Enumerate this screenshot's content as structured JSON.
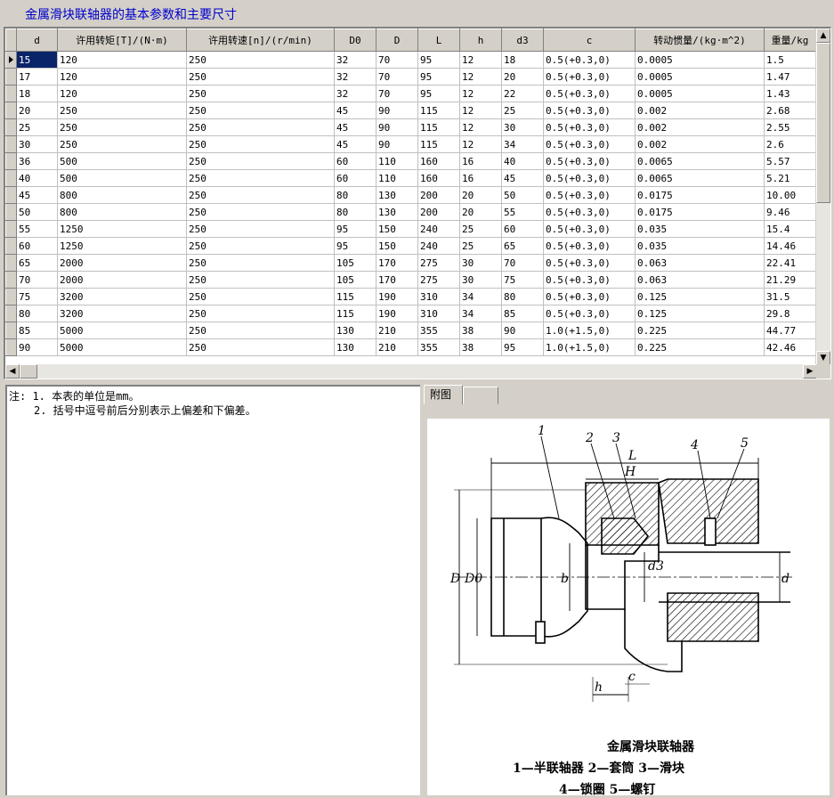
{
  "window": {
    "title": "金属滑块联轴器的基本参数和主要尺寸"
  },
  "table": {
    "columns": [
      "d",
      "许用转矩[T]/(N·m)",
      "许用转速[n]/(r/min)",
      "D0",
      "D",
      "L",
      "h",
      "d3",
      "c",
      "转动惯量/(kg·m^2)",
      "重量/kg"
    ],
    "rows": [
      [
        "15",
        "120",
        "250",
        "32",
        "70",
        "95",
        "12",
        "18",
        "0.5(+0.3,0)",
        "0.0005",
        "1.5"
      ],
      [
        "17",
        "120",
        "250",
        "32",
        "70",
        "95",
        "12",
        "20",
        "0.5(+0.3,0)",
        "0.0005",
        "1.47"
      ],
      [
        "18",
        "120",
        "250",
        "32",
        "70",
        "95",
        "12",
        "22",
        "0.5(+0.3,0)",
        "0.0005",
        "1.43"
      ],
      [
        "20",
        "250",
        "250",
        "45",
        "90",
        "115",
        "12",
        "25",
        "0.5(+0.3,0)",
        "0.002",
        "2.68"
      ],
      [
        "25",
        "250",
        "250",
        "45",
        "90",
        "115",
        "12",
        "30",
        "0.5(+0.3,0)",
        "0.002",
        "2.55"
      ],
      [
        "30",
        "250",
        "250",
        "45",
        "90",
        "115",
        "12",
        "34",
        "0.5(+0.3,0)",
        "0.002",
        "2.6"
      ],
      [
        "36",
        "500",
        "250",
        "60",
        "110",
        "160",
        "16",
        "40",
        "0.5(+0.3,0)",
        "0.0065",
        "5.57"
      ],
      [
        "40",
        "500",
        "250",
        "60",
        "110",
        "160",
        "16",
        "45",
        "0.5(+0.3,0)",
        "0.0065",
        "5.21"
      ],
      [
        "45",
        "800",
        "250",
        "80",
        "130",
        "200",
        "20",
        "50",
        "0.5(+0.3,0)",
        "0.0175",
        "10.00"
      ],
      [
        "50",
        "800",
        "250",
        "80",
        "130",
        "200",
        "20",
        "55",
        "0.5(+0.3,0)",
        "0.0175",
        "9.46"
      ],
      [
        "55",
        "1250",
        "250",
        "95",
        "150",
        "240",
        "25",
        "60",
        "0.5(+0.3,0)",
        "0.035",
        "15.4"
      ],
      [
        "60",
        "1250",
        "250",
        "95",
        "150",
        "240",
        "25",
        "65",
        "0.5(+0.3,0)",
        "0.035",
        "14.46"
      ],
      [
        "65",
        "2000",
        "250",
        "105",
        "170",
        "275",
        "30",
        "70",
        "0.5(+0.3,0)",
        "0.063",
        "22.41"
      ],
      [
        "70",
        "2000",
        "250",
        "105",
        "170",
        "275",
        "30",
        "75",
        "0.5(+0.3,0)",
        "0.063",
        "21.29"
      ],
      [
        "75",
        "3200",
        "250",
        "115",
        "190",
        "310",
        "34",
        "80",
        "0.5(+0.3,0)",
        "0.125",
        "31.5"
      ],
      [
        "80",
        "3200",
        "250",
        "115",
        "190",
        "310",
        "34",
        "85",
        "0.5(+0.3,0)",
        "0.125",
        "29.8"
      ],
      [
        "85",
        "5000",
        "250",
        "130",
        "210",
        "355",
        "38",
        "90",
        "1.0(+1.5,0)",
        "0.225",
        "44.77"
      ],
      [
        "90",
        "5000",
        "250",
        "130",
        "210",
        "355",
        "38",
        "95",
        "1.0(+1.5,0)",
        "0.225",
        "42.46"
      ]
    ]
  },
  "notes": {
    "line1": "注: 1. 本表的单位是mm。",
    "line2": "2. 括号中逗号前后分别表示上偏差和下偏差。"
  },
  "tabs": {
    "tab1": "附图",
    "tab2": ""
  },
  "figure": {
    "labels": {
      "n1": "1",
      "n2": "2",
      "n3": "3",
      "n4": "4",
      "n5": "5",
      "L": "L",
      "H": "H",
      "D": "D",
      "D0": "D0",
      "b": "b",
      "d3": "d3",
      "d": "d",
      "h": "h",
      "c": "c"
    },
    "caption_title": "金属滑块联轴器",
    "caption_line1": "1—半联轴器  2—套筒  3—滑块",
    "caption_line2": "4—锁圈  5—螺钉"
  },
  "scroll": {
    "up": "▲",
    "down": "▼",
    "left": "◀",
    "right": "▶"
  }
}
